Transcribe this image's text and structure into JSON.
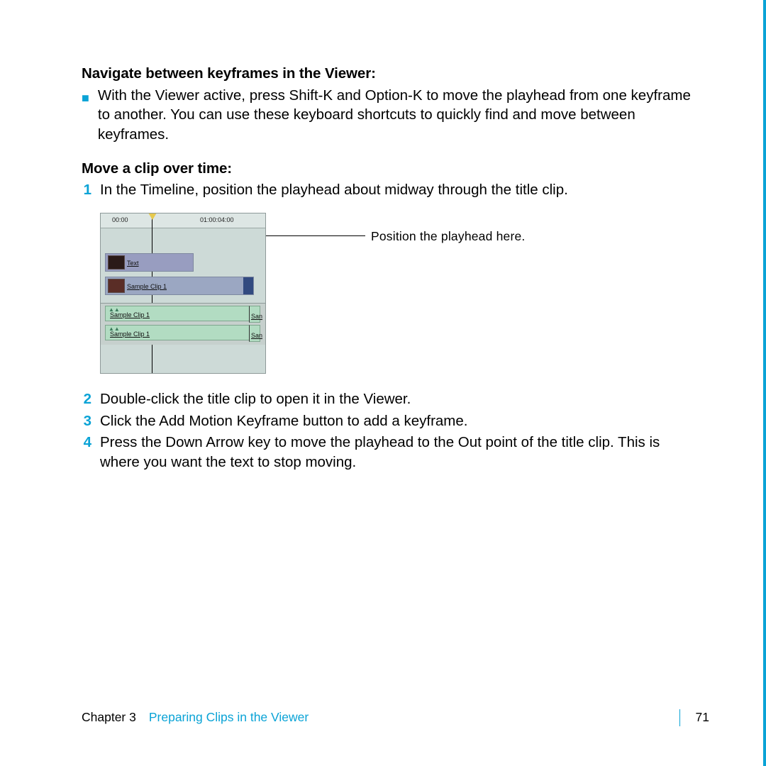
{
  "heading1": "Navigate between keyframes in the Viewer:",
  "bullet1": "With the Viewer active, press Shift-K and Option-K to move the playhead from one keyframe to another. You can use these keyboard shortcuts to quickly find and move between keyframes.",
  "heading2": "Move a clip over time:",
  "steps": {
    "n1": "1",
    "t1": "In the Timeline, position the playhead about midway through the title clip.",
    "n2": "2",
    "t2": "Double-click the title clip to open it in the Viewer.",
    "n3": "3",
    "t3": "Click the Add Motion Keyframe button to add a keyframe.",
    "n4": "4",
    "t4": "Press the Down Arrow key to move the playhead to the Out point of the title clip. This is where you want the text to stop moving."
  },
  "figure": {
    "callout": "Position the playhead here.",
    "ruler_tc1": "00:00",
    "ruler_tc2": "01:00:04:00",
    "video_label": "Text",
    "clip1": "Sample Clip 1",
    "audio1": "Sample Clip 1",
    "audio2": "Sample Clip 1",
    "audio_next1": "San",
    "audio_next2": "San"
  },
  "footer": {
    "chapter_label": "Chapter 3",
    "chapter_title": "Preparing Clips in the Viewer",
    "page": "71"
  }
}
